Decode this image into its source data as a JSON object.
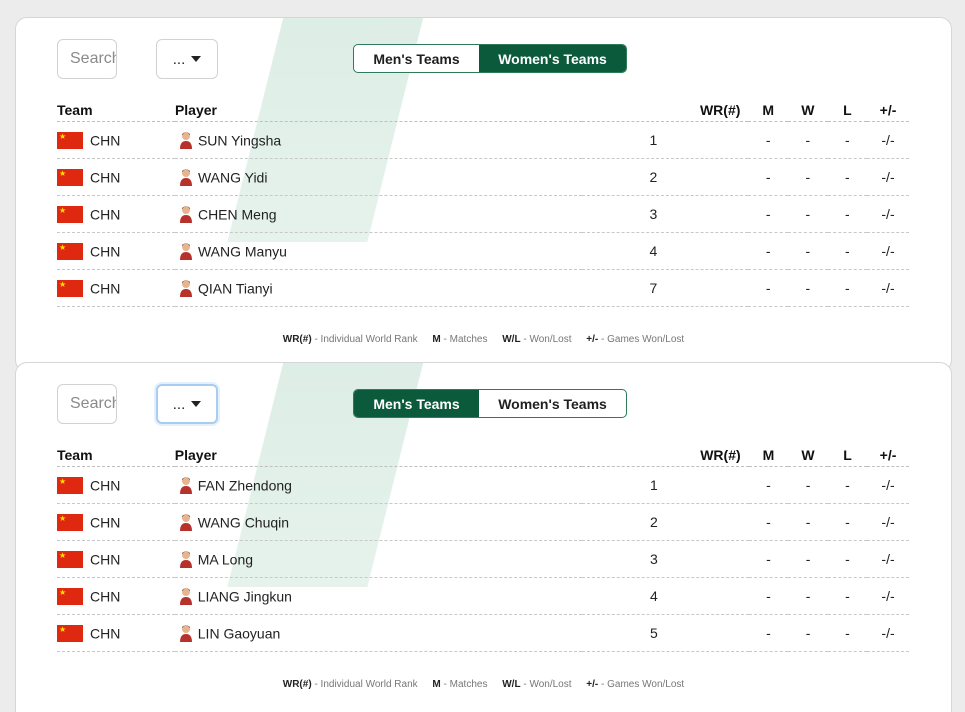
{
  "panels": [
    {
      "search_placeholder": "Search",
      "filter_label": "...",
      "toggle": {
        "men": "Men's Teams",
        "women": "Women's Teams",
        "active": "women"
      },
      "headers": {
        "team": "Team",
        "player": "Player",
        "wr": "WR(#)",
        "m": "M",
        "w": "W",
        "l": "L",
        "pm": "+/-"
      },
      "rows": [
        {
          "team": "CHN",
          "player": "SUN Yingsha",
          "wr": "1",
          "m": "-",
          "w": "-",
          "l": "-",
          "pm": "-/-"
        },
        {
          "team": "CHN",
          "player": "WANG Yidi",
          "wr": "2",
          "m": "-",
          "w": "-",
          "l": "-",
          "pm": "-/-"
        },
        {
          "team": "CHN",
          "player": "CHEN Meng",
          "wr": "3",
          "m": "-",
          "w": "-",
          "l": "-",
          "pm": "-/-"
        },
        {
          "team": "CHN",
          "player": "WANG Manyu",
          "wr": "4",
          "m": "-",
          "w": "-",
          "l": "-",
          "pm": "-/-"
        },
        {
          "team": "CHN",
          "player": "QIAN Tianyi",
          "wr": "7",
          "m": "-",
          "w": "-",
          "l": "-",
          "pm": "-/-"
        }
      ],
      "legend": {
        "wr_key": "WR(#)",
        "wr_text": "- Individual World Rank",
        "m_key": "M",
        "m_text": "- Matches",
        "wl_key": "W/L",
        "wl_text": "- Won/Lost",
        "pm_key": "+/-",
        "pm_text": "- Games Won/Lost"
      }
    },
    {
      "search_placeholder": "Search",
      "filter_label": "...",
      "toggle": {
        "men": "Men's Teams",
        "women": "Women's Teams",
        "active": "men"
      },
      "headers": {
        "team": "Team",
        "player": "Player",
        "wr": "WR(#)",
        "m": "M",
        "w": "W",
        "l": "L",
        "pm": "+/-"
      },
      "rows": [
        {
          "team": "CHN",
          "player": "FAN Zhendong",
          "wr": "1",
          "m": "-",
          "w": "-",
          "l": "-",
          "pm": "-/-"
        },
        {
          "team": "CHN",
          "player": "WANG Chuqin",
          "wr": "2",
          "m": "-",
          "w": "-",
          "l": "-",
          "pm": "-/-"
        },
        {
          "team": "CHN",
          "player": "MA Long",
          "wr": "3",
          "m": "-",
          "w": "-",
          "l": "-",
          "pm": "-/-"
        },
        {
          "team": "CHN",
          "player": "LIANG Jingkun",
          "wr": "4",
          "m": "-",
          "w": "-",
          "l": "-",
          "pm": "-/-"
        },
        {
          "team": "CHN",
          "player": "LIN Gaoyuan",
          "wr": "5",
          "m": "-",
          "w": "-",
          "l": "-",
          "pm": "-/-"
        }
      ],
      "legend": {
        "wr_key": "WR(#)",
        "wr_text": "- Individual World Rank",
        "m_key": "M",
        "m_text": "- Matches",
        "wl_key": "W/L",
        "wl_text": "- Won/Lost",
        "pm_key": "+/-",
        "pm_text": "- Games Won/Lost"
      }
    }
  ],
  "colors": {
    "accent_green": "#0c5a3c",
    "flag_red": "#de2910",
    "flag_star": "#ffde00"
  },
  "icons": {
    "flag": "china-flag-icon",
    "avatar": "player-avatar-icon",
    "dropdown": "caret-down-icon"
  }
}
